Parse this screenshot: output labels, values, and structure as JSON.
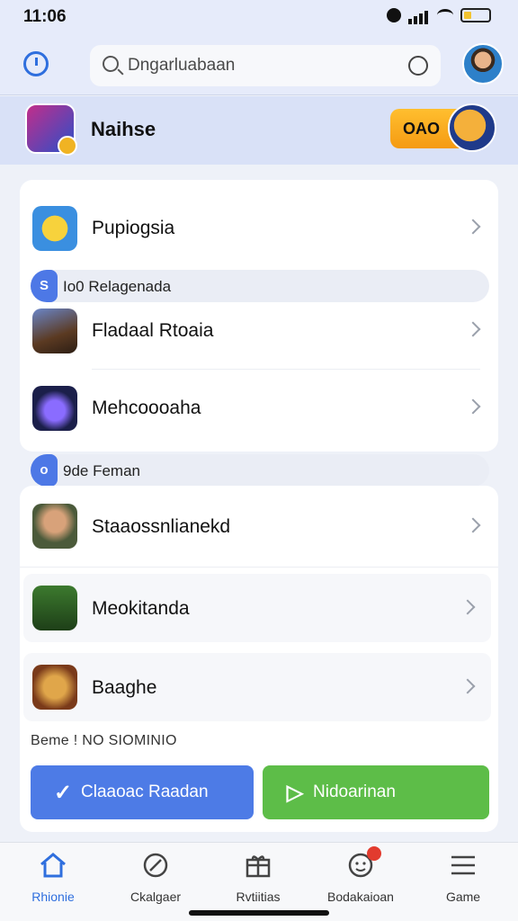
{
  "status_bar": {
    "time": "11:06"
  },
  "search": {
    "placeholder": "Dngarluabaan"
  },
  "profile": {
    "name": "Naihse",
    "coin_label": "OAO"
  },
  "list_top": [
    {
      "label": "Pupiogsia",
      "icon": "pikachu-game-icon"
    }
  ],
  "section_1": {
    "badge": "S",
    "label": "Io0 Relagenada"
  },
  "list_mid": [
    {
      "label": "Fladaal Rtoaia",
      "icon": "warrior-game-icon"
    },
    {
      "label": "Mehcoooaha",
      "icon": "spaceship-game-icon"
    }
  ],
  "section_2": {
    "badge": "o",
    "label": "9de Feman"
  },
  "list_bottom": [
    {
      "label": "Staaossnlianekd",
      "icon": "soldier-game-icon"
    },
    {
      "label": "Meokitanda",
      "icon": "tank-game-icon"
    },
    {
      "label": "Baaghe",
      "icon": "lion-game-icon"
    }
  ],
  "footnote": "Beme ! NO SIOMINIO",
  "buttons": {
    "primary": {
      "label": "Claaoac Raadan",
      "icon": "check-icon"
    },
    "secondary": {
      "label": "Nidoarinan",
      "icon": "play-icon"
    }
  },
  "nav": [
    {
      "label": "Rhionie",
      "icon": "home-icon",
      "active": true
    },
    {
      "label": "Ckalgaer",
      "icon": "compass-icon",
      "active": false
    },
    {
      "label": "Rvtiitias",
      "icon": "gift-icon",
      "active": false
    },
    {
      "label": "Bodakaioan",
      "icon": "smiley-icon",
      "active": false,
      "badge": true
    },
    {
      "label": "Game",
      "icon": "menu-icon",
      "active": false
    }
  ],
  "colors": {
    "accent": "#4d7be6",
    "green": "#5dbd48",
    "coin": "#f59a12",
    "notification": "#e23b2e"
  }
}
